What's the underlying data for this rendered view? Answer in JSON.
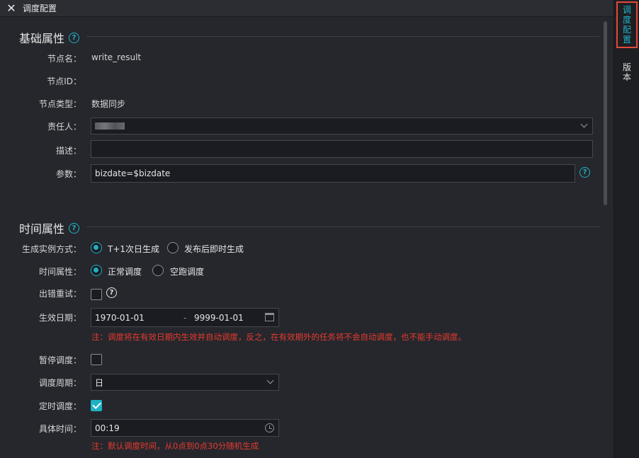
{
  "header": {
    "title": "调度配置",
    "close_icon": "close-icon"
  },
  "right_tabs": {
    "schedule": [
      "调",
      "度",
      "配",
      "置"
    ],
    "version": [
      "版",
      "本"
    ]
  },
  "basic": {
    "title": "基础属性",
    "node_name_label": "节点名：",
    "node_name_value": "write_result",
    "node_id_label": "节点ID：",
    "node_type_label": "节点类型：",
    "node_type_value": "数据同步",
    "owner_label": "责任人：",
    "desc_label": "描述：",
    "param_label": "参数：",
    "param_value": "bizdate=$bizdate"
  },
  "time": {
    "title": "时间属性",
    "instance_label": "生成实例方式：",
    "instance_opt1": "T+1次日生成",
    "instance_opt2": "发布后即时生成",
    "time_attr_label": "时间属性：",
    "time_opt1": "正常调度",
    "time_opt2": "空跑调度",
    "retry_label": "出错重试：",
    "date_label": "生效日期：",
    "date_start": "1970-01-01",
    "date_sep": "-",
    "date_end": "9999-01-01",
    "date_note": "注：调度将在有效日期内生效并自动调度，反之，在有效期外的任务将不会自动调度，也不能手动调度。",
    "pause_label": "暂停调度：",
    "period_label": "调度周期：",
    "period_value": "日",
    "timed_label": "定时调度：",
    "specific_label": "具体时间：",
    "specific_value": "00:19",
    "time_note": "注：默认调度时间，从0点到0点30分随机生成"
  },
  "colors": {
    "accent": "#1fb1c6",
    "warning": "#e8392d",
    "active_tab_border": "#e2493b"
  }
}
